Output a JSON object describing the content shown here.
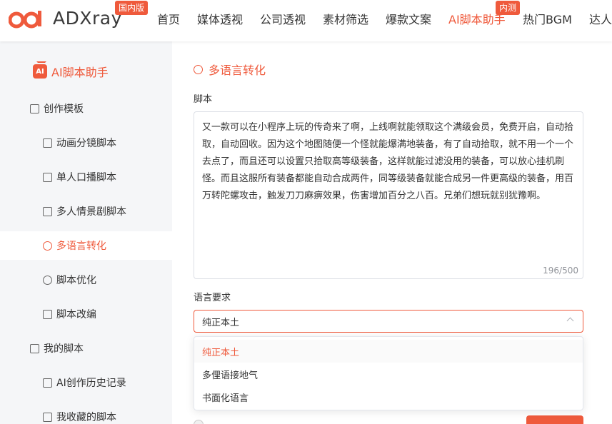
{
  "header": {
    "logo_text": "ADXray",
    "region_badge": "国内版",
    "nav": [
      {
        "label": "首页"
      },
      {
        "label": "媒体透视"
      },
      {
        "label": "公司透视"
      },
      {
        "label": "素材筛选"
      },
      {
        "label": "爆款文案"
      },
      {
        "label": "AI脚本助手",
        "active": true,
        "badge": "内测"
      },
      {
        "label": "热门BGM"
      },
      {
        "label": "达人"
      }
    ],
    "accent_color": "#ef5a3c"
  },
  "sidebar": {
    "title": "AI脚本助手",
    "groups": [
      {
        "label": "创作模板",
        "icon": "edit-icon",
        "items": [
          {
            "label": "动画分镜脚本",
            "icon": "storyboard-icon"
          },
          {
            "label": "单人口播脚本",
            "icon": "tv-icon"
          },
          {
            "label": "多人情景剧脚本",
            "icon": "image-icon"
          },
          {
            "label": "多语言转化",
            "icon": "globe-icon",
            "active": true
          },
          {
            "label": "脚本优化",
            "icon": "clock-icon"
          },
          {
            "label": "脚本改编",
            "icon": "edit-icon"
          }
        ]
      },
      {
        "label": "我的脚本",
        "icon": "script-icon",
        "items": [
          {
            "label": "AI创作历史记录",
            "icon": "history-icon"
          },
          {
            "label": "我收藏的脚本",
            "icon": "star-icon"
          }
        ]
      }
    ]
  },
  "main": {
    "title": "多语言转化",
    "script_label": "脚本",
    "script_text": "又一款可以在小程序上玩的传奇来了啊，上线啊就能领取这个满级会员，免费开启，自动拾取，自动回收。因为这个地图随便一个怪就能爆满地装备，有了自动拾取，就不用一个一个去点了，而且还可以设置只拾取高等级装备，这样就能过滤没用的装备，可以放心挂机刷怪。而且这服所有装备都能自动合成两件，同等级装备就能合成另一件更高级的装备，用百万转陀螺攻击，触发刀刀麻痹效果，伤害增加百分之八百。兄弟们想玩就别犹豫啊。",
    "script_counter": "196/500",
    "language_label": "语言要求",
    "language_selected": "纯正本土",
    "language_options": [
      "纯正本土",
      "多俚语接地气",
      "书面化语言"
    ]
  }
}
